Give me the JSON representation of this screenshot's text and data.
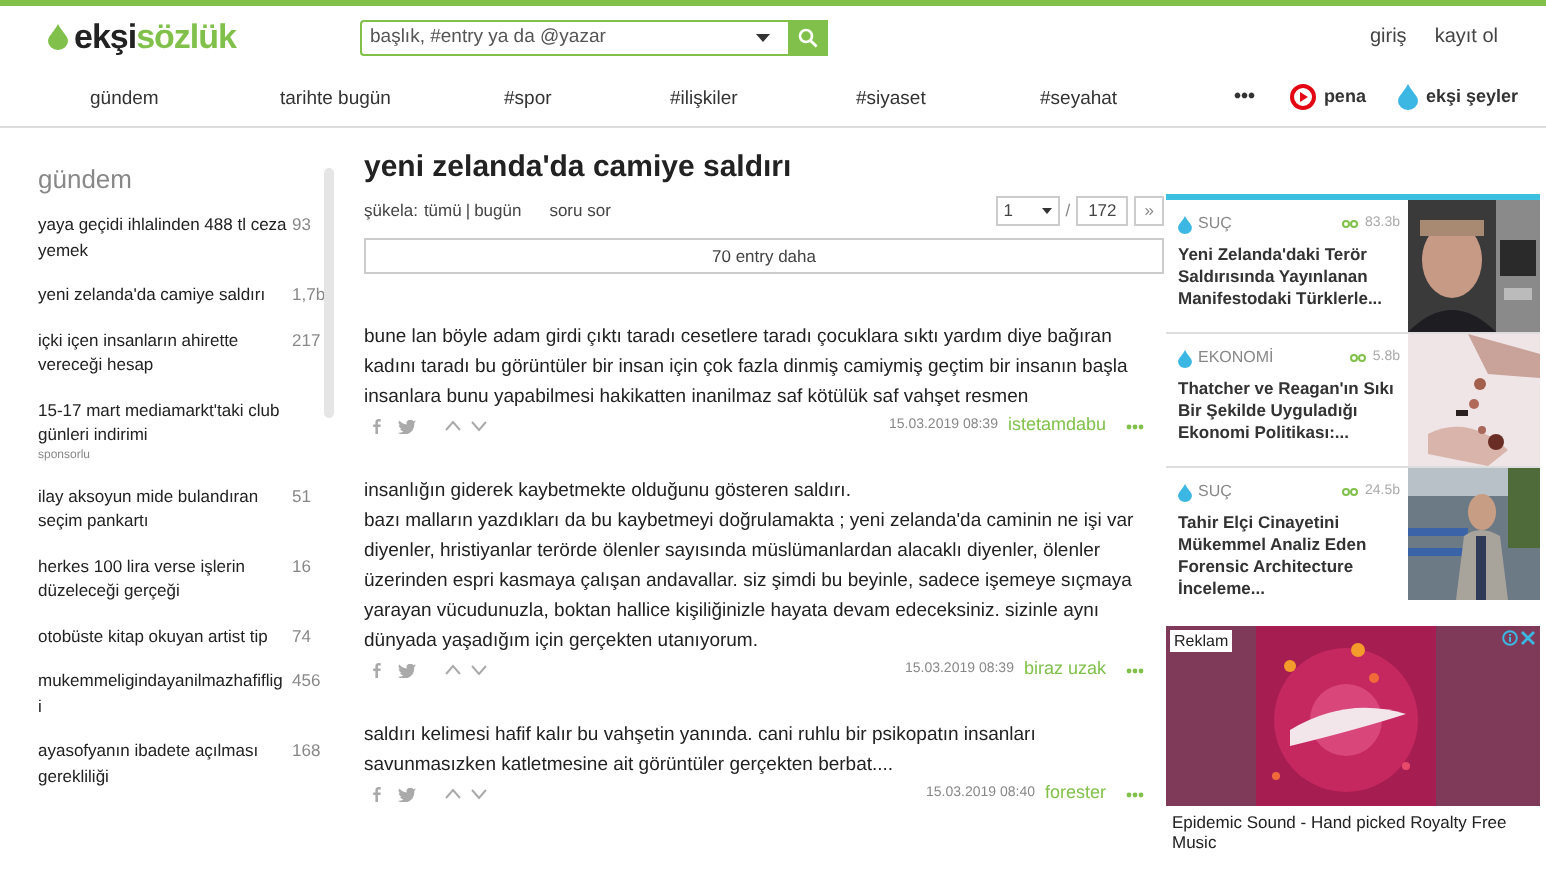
{
  "header": {
    "logo_a": "ekşi",
    "logo_b": "sözlük",
    "search": {
      "placeholder": "başlık, #entry ya da @yazar"
    },
    "links": [
      "giriş",
      "kayıt ol"
    ]
  },
  "nav": {
    "items": [
      "gündem",
      "tarihte bugün",
      "#spor",
      "#ilişkiler",
      "#siyaset",
      "#seyahat"
    ],
    "more": "•••",
    "brands": [
      {
        "kind": "pena",
        "label": "pena"
      },
      {
        "kind": "drop",
        "label": "ekşi şeyler"
      }
    ]
  },
  "sidebar": {
    "title": "gündem",
    "items": [
      {
        "title": "yaya geçidi ihlalinden 488 tl ceza yemek",
        "count": "93"
      },
      {
        "title": "yeni zelanda'da camiye saldırı",
        "count": "1,7b"
      },
      {
        "title": "içki içen insanların ahirette vereceği hesap",
        "count": "217"
      },
      {
        "title": "15-17 mart mediamarkt'taki club günleri indirimi",
        "note": "sponsorlu"
      },
      {
        "title": "ilay aksoyun mide bulandıran seçim pankartı",
        "count": "51"
      },
      {
        "title": "herkes 100 lira verse işlerin düzeleceği gerçeği",
        "count": "16"
      },
      {
        "title": "otobüste kitap okuyan artist tip",
        "count": "74"
      },
      {
        "title": "mukemmeligindayanilmazhafiflig i",
        "count": "456"
      },
      {
        "title": "ayasofyanın ibadete açılması gerekliliği",
        "count": "168"
      }
    ]
  },
  "topic": {
    "title": "yeni zelanda'da camiye saldırı",
    "sukela_label": "şükela:",
    "sukela_all": "tümü",
    "sukela_sep": "|",
    "sukela_today": "bugün",
    "ask": "soru sor",
    "page": "1",
    "separator": "/",
    "total": "172",
    "next": "»",
    "more_button": "70 entry daha"
  },
  "entries": [
    {
      "text": "bune lan böyle adam girdi çıktı taradı cesetlere taradı çocuklara sıktı yardım diye bağıran kadını taradı bu görüntüler bir insan için çok fazla dinmiş camiymiş geçtim bir insanın başla insanlara bunu yapabilmesi hakikatten inanilmaz saf kötülük saf vahşet resmen",
      "date": "15.03.2019 08:39",
      "author": "istetamdabu"
    },
    {
      "text": "insanlığın giderek kaybetmekte olduğunu gösteren saldırı.\nbazı malların yazdıkları da bu kaybetmeyi doğrulamakta ; yeni zelanda'da caminin ne işi var diyenler, hristiyanlar terörde ölenler sayısında müslümanlardan alacaklı diyenler, ölenler üzerinden espri kasmaya çalışan andavallar. siz şimdi bu beyinle, sadece işemeye sıçmaya yarayan vücudunuzla, boktan hallice kişiliğinizle hayata devam edeceksiniz. sizinle aynı dünyada yaşadığım için gerçekten utanıyorum.",
      "date": "15.03.2019 08:39",
      "author": "biraz uzak"
    },
    {
      "text": "saldırı kelimesi hafif kalır bu vahşetin yanında. cani ruhlu bir psikopatın insanları savunmasızken katletmesine ait görüntüler gerçekten berbat....",
      "date": "15.03.2019 08:40",
      "author": "forester"
    }
  ],
  "cards": [
    {
      "category": "SUÇ",
      "views": "83.3b",
      "title": "Yeni Zelanda'daki Terör Saldırısında Yayınlanan Manifestodaki Türklerle..."
    },
    {
      "category": "EKONOMİ",
      "views": "5.8b",
      "title": "Thatcher ve Reagan'ın Sıkı Bir Şekilde Uyguladığı Ekonomi Politikası:..."
    },
    {
      "category": "SUÇ",
      "views": "24.5b",
      "title": "Tahir Elçi Cinayetini Mükemmel Analiz Eden Forensic Architecture İnceleme..."
    }
  ],
  "ad": {
    "badge": "Reklam",
    "caption": "Epidemic Sound - Hand picked Royalty Free Music"
  }
}
